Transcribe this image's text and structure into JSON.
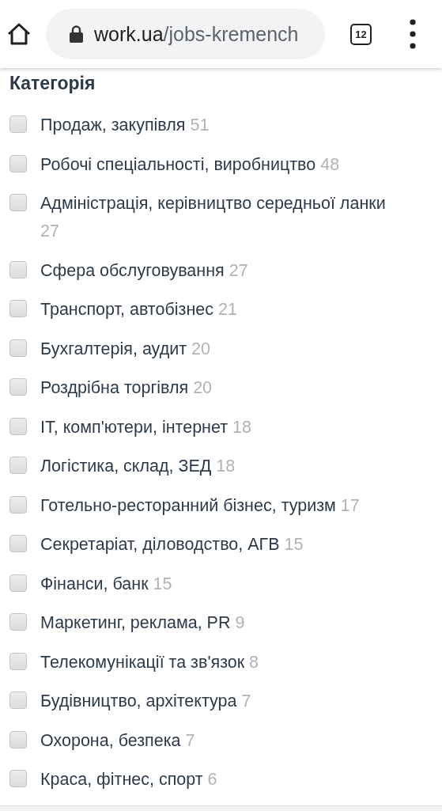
{
  "browser": {
    "url_domain": "work.ua",
    "url_path": "/jobs-kremench",
    "tab_count": "12"
  },
  "filter": {
    "title": "Категорія",
    "items": [
      {
        "label": "Продаж, закупівля",
        "count": "51",
        "checked": false
      },
      {
        "label": "Робочі спеціальності, виробництво",
        "count": "48",
        "checked": false
      },
      {
        "label": "Адміністрація, керівництво середньої ланки",
        "count": "27",
        "checked": false
      },
      {
        "label": "Сфера обслуговування",
        "count": "27",
        "checked": false
      },
      {
        "label": "Транспорт, автобізнес",
        "count": "21",
        "checked": false
      },
      {
        "label": "Бухгалтерія, аудит",
        "count": "20",
        "checked": false
      },
      {
        "label": "Роздрібна торгівля",
        "count": "20",
        "checked": false
      },
      {
        "label": "IT, комп'ютери, інтернет",
        "count": "18",
        "checked": false
      },
      {
        "label": "Логістика, склад, ЗЕД",
        "count": "18",
        "checked": false
      },
      {
        "label": "Готельно-ресторанний бізнес, туризм",
        "count": "17",
        "checked": false
      },
      {
        "label": "Секретаріат, діловодство, АГВ",
        "count": "15",
        "checked": false
      },
      {
        "label": "Фінанси, банк",
        "count": "15",
        "checked": false
      },
      {
        "label": "Маркетинг, реклама, PR",
        "count": "9",
        "checked": false
      },
      {
        "label": "Телекомунікації та зв'язок",
        "count": "8",
        "checked": false
      },
      {
        "label": "Будівництво, архітектура",
        "count": "7",
        "checked": false
      },
      {
        "label": "Охорона, безпека",
        "count": "7",
        "checked": false
      },
      {
        "label": "Краса, фітнес, спорт",
        "count": "6",
        "checked": false
      }
    ]
  }
}
